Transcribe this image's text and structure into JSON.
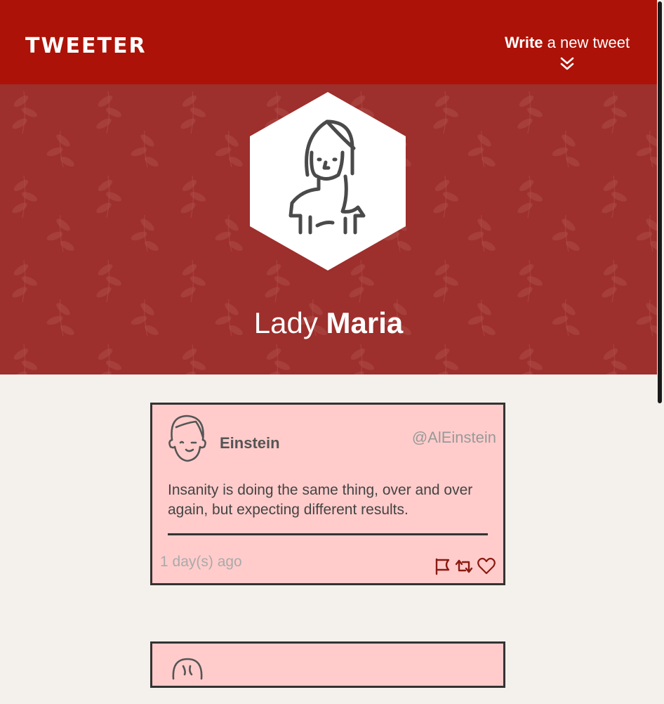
{
  "header": {
    "brand": "TWEETER",
    "write_bold": "Write",
    "write_rest": " a new tweet",
    "accent_color": "#ac1207"
  },
  "hero": {
    "first_name": "Lady",
    "last_name": "Maria",
    "background_color": "#9d2f2c",
    "avatar_icon": "woman-avatar-icon"
  },
  "tweets": [
    {
      "author": "Einstein",
      "handle": "@AlEinstein",
      "text": "Insanity is doing the same thing, over and over again, but expecting different results.",
      "time": "1 day(s) ago",
      "avatar_icon": "man-avatar-icon",
      "actions": [
        "flag-icon",
        "retweet-icon",
        "heart-icon"
      ],
      "background_color": "#ffcccb"
    }
  ]
}
